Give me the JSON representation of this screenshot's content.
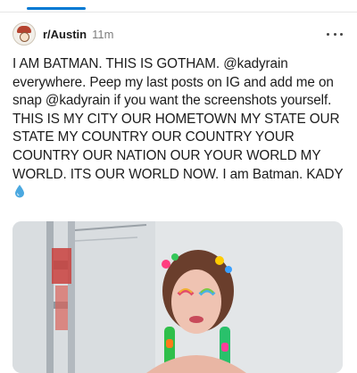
{
  "post": {
    "subreddit": "r/Austin",
    "age": "11m",
    "body": "I AM BATMAN. THIS IS GOTHAM. @kadyrain everywhere. Peep my last posts on IG and add me on snap @kadyrain if you want the screenshots yourself. THIS IS MY CITY OUR HOMETOWN MY STATE OUR STATE MY COUNTRY OUR COUNTRY YOUR COUNTRY OUR NATION OUR YOUR WORLD MY WORLD. ITS OUR WORLD NOW. I am Batman. KADY"
  },
  "colors": {
    "accent": "#0079d3",
    "droplet": "#4aa8e0",
    "text": "#1c1c1c",
    "muted": "#7c7c7c"
  },
  "icons": {
    "avatar": "snoo-avatar",
    "more": "more-horizontal-icon",
    "droplet": "droplet-emoji"
  }
}
